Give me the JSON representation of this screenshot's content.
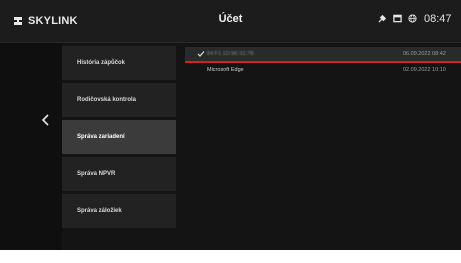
{
  "header": {
    "logo_text": "SKYLINK",
    "title": "Účet",
    "time": "08:47",
    "icons": [
      "satellite-icon",
      "message-icon",
      "globe-icon"
    ]
  },
  "nav": {
    "back_icon": "chevron-left-icon"
  },
  "menu": {
    "items": [
      {
        "label": "História zápůčok",
        "active": false
      },
      {
        "label": "Rodičovská kontrola",
        "active": false
      },
      {
        "label": "Správa zariadení",
        "active": true
      },
      {
        "label": "Správa NPVR",
        "active": false
      },
      {
        "label": "Správa záložiek",
        "active": false
      }
    ]
  },
  "devices": {
    "rows": [
      {
        "name": "84:F1:1D:9E:31:7B",
        "date": "06.09.2022 08:42",
        "selected": true,
        "check_icon": "check-icon"
      },
      {
        "name": "Microsoft Edge",
        "date": "02.09.2022 10:10",
        "selected": false
      }
    ]
  },
  "colors": {
    "accent": "#d21f1f",
    "background": "#141414",
    "panel": "#222222",
    "panel_active": "#3b3b3b"
  }
}
